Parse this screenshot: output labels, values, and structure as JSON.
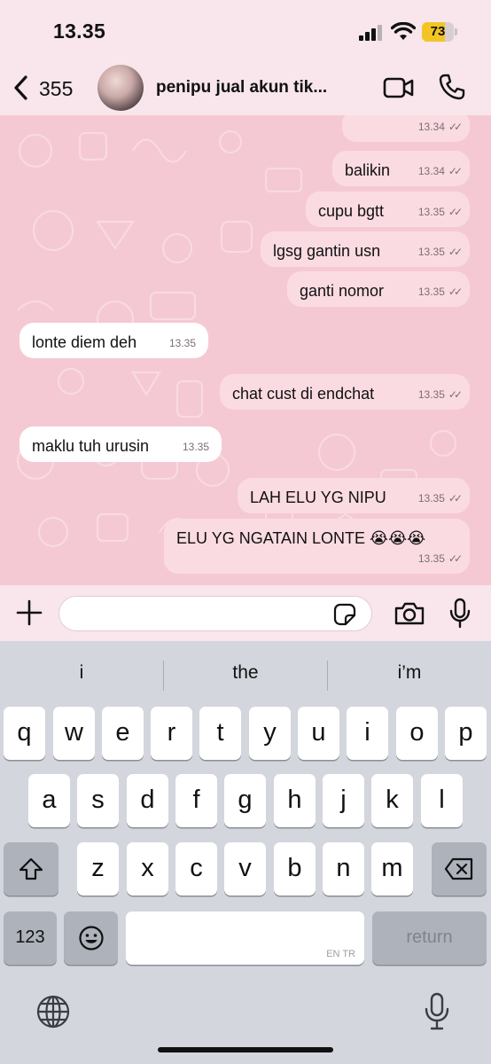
{
  "status_bar": {
    "time": "13.35",
    "battery": "73",
    "battery_fraction": 0.73,
    "battery_color": "#f3c524"
  },
  "header": {
    "back_count": "355",
    "chat_title": "penipu jual akun tik...",
    "icons": [
      "chevron-left-icon",
      "avatar",
      "video-call-icon",
      "phone-icon"
    ]
  },
  "messages": [
    {
      "dir": "out",
      "text": "",
      "time": "13.34",
      "status": "read"
    },
    {
      "dir": "out",
      "text": "balikin",
      "time": "13.34",
      "status": "read"
    },
    {
      "dir": "out",
      "text": "cupu bgtt",
      "time": "13.35",
      "status": "read"
    },
    {
      "dir": "out",
      "text": "lgsg gantin usn",
      "time": "13.35",
      "status": "read"
    },
    {
      "dir": "out",
      "text": "ganti nomor",
      "time": "13.35",
      "status": "read"
    },
    {
      "dir": "in",
      "text": "lonte diem deh",
      "time": "13.35"
    },
    {
      "dir": "out",
      "text": "chat cust di endchat",
      "time": "13.35",
      "status": "read"
    },
    {
      "dir": "in",
      "text": "maklu tuh urusin",
      "time": "13.35"
    },
    {
      "dir": "out",
      "text": "LAH ELU YG NIPU",
      "time": "13.35",
      "status": "read"
    },
    {
      "dir": "out",
      "text": "ELU YG NGATAIN LONTE 😭😭😭",
      "time": "13.35",
      "status": "read"
    }
  ],
  "input": {
    "placeholder": "",
    "icons": [
      "plus-icon",
      "sticker-icon",
      "camera-icon",
      "microphone-icon"
    ]
  },
  "keyboard": {
    "suggestions": [
      "i",
      "the",
      "i’m"
    ],
    "row1": [
      "q",
      "w",
      "e",
      "r",
      "t",
      "y",
      "u",
      "i",
      "o",
      "p"
    ],
    "row2": [
      "a",
      "s",
      "d",
      "f",
      "g",
      "h",
      "j",
      "k",
      "l"
    ],
    "row3": [
      "z",
      "x",
      "c",
      "v",
      "b",
      "n",
      "m"
    ],
    "numbers_key": "123",
    "return_key": "return",
    "space_lang": "EN TR",
    "icons": [
      "shift-icon",
      "backspace-icon",
      "emoji-icon",
      "globe-icon",
      "dictation-mic-icon"
    ]
  },
  "colors": {
    "chat_background": "#f5c9d3",
    "outgoing_bubble": "#fbdbe2",
    "incoming_bubble": "#ffffff",
    "header_background": "#f8e6ec",
    "keyboard_background": "#d3d6dd"
  }
}
